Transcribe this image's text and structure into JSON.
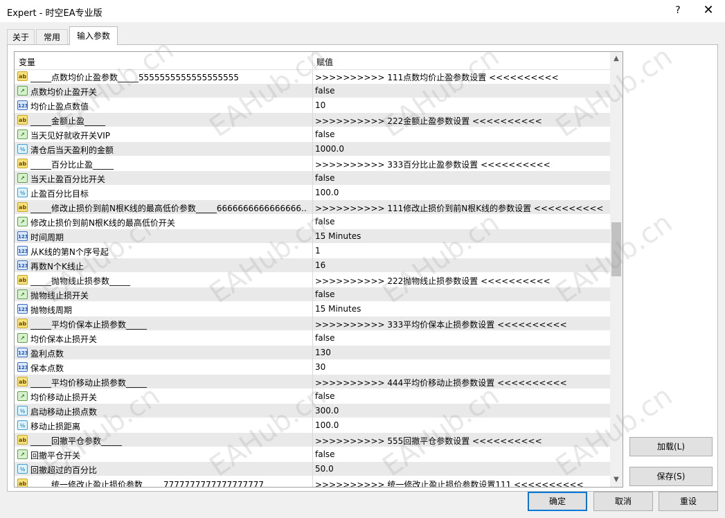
{
  "window": {
    "title": "Expert - 时空EA专业版",
    "help_glyph": "?",
    "close_glyph": "✕"
  },
  "tabs": [
    {
      "label": "关于",
      "active": false
    },
    {
      "label": "常用",
      "active": false
    },
    {
      "label": "输入参数",
      "active": true
    }
  ],
  "grid": {
    "col_variable": "变量",
    "col_value": "赋值",
    "scroll_up": "▲",
    "scroll_down": "▼",
    "rows": [
      {
        "type": "ab",
        "name": "_____点数均价止盈参数_____5555555555555555555",
        "value": ">>>>>>>>>> 111点数均价止盈参数设置 <<<<<<<<<<"
      },
      {
        "type": "bool",
        "name": "点数均价止盈开关",
        "value": "false"
      },
      {
        "type": "int",
        "name": "均价止盈点数值",
        "value": "10"
      },
      {
        "type": "ab",
        "name": "_____金额止盈_____",
        "value": ">>>>>>>>>> 222金额止盈参数设置 <<<<<<<<<<"
      },
      {
        "type": "bool",
        "name": "当天见好就收开关VIP",
        "value": "false"
      },
      {
        "type": "dbl",
        "name": "清仓后当天盈利的金额",
        "value": "1000.0"
      },
      {
        "type": "ab",
        "name": "_____百分比止盈_____",
        "value": ">>>>>>>>>> 333百分比止盈参数设置 <<<<<<<<<<"
      },
      {
        "type": "bool",
        "name": "当天止盈百分比开关",
        "value": "false"
      },
      {
        "type": "dbl",
        "name": "止盈百分比目标",
        "value": "100.0"
      },
      {
        "type": "ab",
        "name": "_____修改止损价到前N根K线的最高低价参数_____6666666666666666...",
        "value": ">>>>>>>>>> 111修改止损价到前N根K线的参数设置 <<<<<<<<<<"
      },
      {
        "type": "bool",
        "name": "修改止损价到前N根K线的最高低价开关",
        "value": "false"
      },
      {
        "type": "int",
        "name": "时间周期",
        "value": "15 Minutes"
      },
      {
        "type": "int",
        "name": "从K线的第N个序号起",
        "value": "1"
      },
      {
        "type": "int",
        "name": "再数N个K线止",
        "value": "16"
      },
      {
        "type": "ab",
        "name": "_____抛物线止损参数_____",
        "value": ">>>>>>>>>> 222抛物线止损参数设置 <<<<<<<<<<"
      },
      {
        "type": "bool",
        "name": "抛物线止损开关",
        "value": "false"
      },
      {
        "type": "int",
        "name": "抛物线周期",
        "value": "15 Minutes"
      },
      {
        "type": "ab",
        "name": "_____平均价保本止损参数_____",
        "value": ">>>>>>>>>> 333平均价保本止损参数设置 <<<<<<<<<<"
      },
      {
        "type": "bool",
        "name": "均价保本止损开关",
        "value": "false"
      },
      {
        "type": "int",
        "name": "盈利点数",
        "value": "130"
      },
      {
        "type": "int",
        "name": "保本点数",
        "value": "30"
      },
      {
        "type": "ab",
        "name": "_____平均价移动止损参数_____",
        "value": ">>>>>>>>>> 444平均价移动止损参数设置 <<<<<<<<<<"
      },
      {
        "type": "bool",
        "name": "均价移动止损开关",
        "value": "false"
      },
      {
        "type": "dbl",
        "name": "启动移动止损点数",
        "value": "300.0"
      },
      {
        "type": "dbl",
        "name": "移动止损距离",
        "value": "100.0"
      },
      {
        "type": "ab",
        "name": "_____回撤平仓参数_____",
        "value": ">>>>>>>>>> 555回撤平仓参数设置 <<<<<<<<<<"
      },
      {
        "type": "bool",
        "name": "回撤平仓开关",
        "value": "false"
      },
      {
        "type": "dbl",
        "name": "回撤超过的百分比",
        "value": "50.0"
      },
      {
        "type": "ab",
        "name": "_____统一修改止盈止损价参数_____7777777777777777777",
        "value": ">>>>>>>>>> 统一修改止盈止损价参数设置111 <<<<<<<<<<"
      }
    ]
  },
  "icons": {
    "ab": "ab",
    "bool": "↗",
    "int": "123",
    "dbl": "½"
  },
  "buttons": {
    "load": "加载(L)",
    "save": "保存(S)",
    "ok": "确定",
    "cancel": "取消",
    "reset": "重设"
  },
  "watermark": "EAHub.cn"
}
